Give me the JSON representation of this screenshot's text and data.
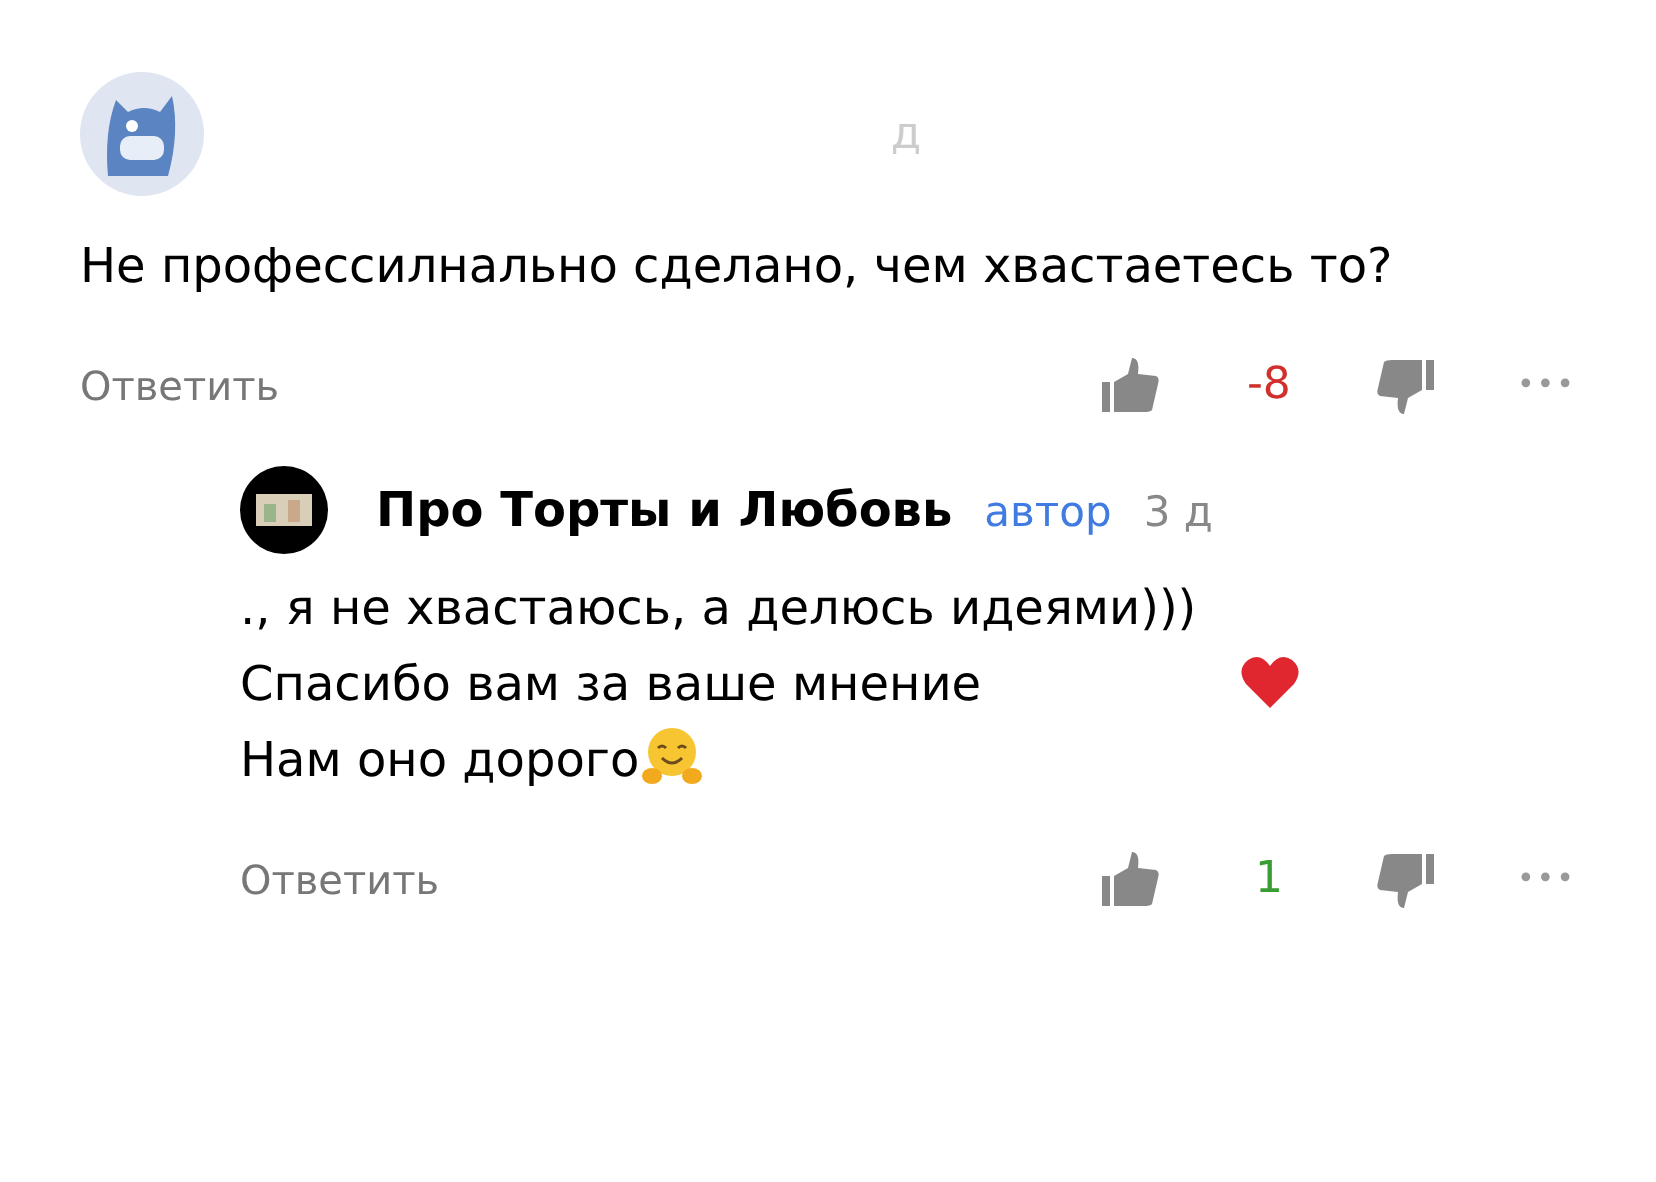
{
  "comment": {
    "time": "д",
    "text": "Не профессилнально сделано, чем хвастаетесь то?",
    "reply_link": "Ответить",
    "score": "-8",
    "color": "#d0312d",
    "more": "•••"
  },
  "reply": {
    "author": "Про Торты и Любовь",
    "badge": "автор",
    "time": "3 д",
    "text_parts": [
      "., я не хвастаюсь, а делюсь идеями))) Спасибо вам за ваше мнение",
      "Нам оно дорого"
    ],
    "reply_link": "Ответить",
    "score": "1",
    "color": "#3a9d34",
    "more": "•••"
  }
}
